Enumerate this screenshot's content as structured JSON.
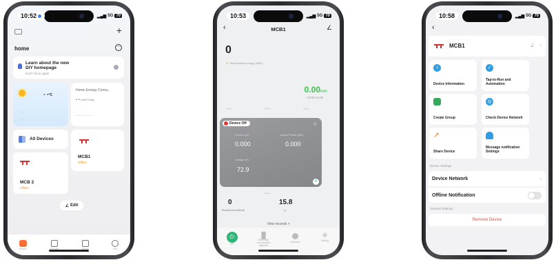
{
  "phone1": {
    "time": "10:52",
    "network": "5G",
    "battery": "70",
    "home_title": "home",
    "banner": {
      "title_line1": "Learn about the new",
      "title_line2": "DIY homepage",
      "subtitle": "Don't show again"
    },
    "weather": {
      "temp": "- -",
      "unit": "°C",
      "dashes1": "- -",
      "dashes2": "- -"
    },
    "energy": {
      "title": "Home Energy Consu...",
      "value": "- -",
      "unit": "kWh/Today",
      "dashes": "- - - - - - -"
    },
    "all_devices_label": "All Devices",
    "devices": [
      {
        "name": "MCB1",
        "status": "Offline"
      },
      {
        "name": "MCB 2",
        "status": "Offline"
      }
    ],
    "edit_label": "Edit",
    "tabs": [
      "Home",
      "Scenes",
      "Smart",
      "Me"
    ],
    "colors": {
      "offline": "#ff8a00",
      "accent": "#ff6b35"
    }
  },
  "phone2": {
    "time": "10:53",
    "network": "5G",
    "battery": "70",
    "title": "MCB1",
    "forward_value": "0",
    "forward_label": "Total forward energy (kWh)",
    "chart_value": "0.00",
    "chart_unit": "kWh",
    "chart_time": "10:00-11:00",
    "chart_axis": [
      "8:00",
      "10:00",
      "20:00"
    ],
    "device_status": "Device Off",
    "current_label": "Current (A)",
    "current_value": "0.000",
    "power_label": "Active Power (kW)",
    "power_value": "0.000",
    "voltage_label": "Voltage (V)",
    "voltage_value": "72.9",
    "badge": "A",
    "residual_value": "0",
    "residual_label": "Residual current(mA)",
    "temp_value": "15.8",
    "temp_label": "°C",
    "view_records": "View records >",
    "bottom": [
      {
        "label": "OFF",
        "icon": "power-icon"
      },
      {
        "label": "Electricity consumption statistics",
        "icon": "bars-icon"
      },
      {
        "label": "Schedule",
        "icon": "clock-icon"
      },
      {
        "label": "Setting",
        "icon": "gear-icon"
      }
    ],
    "colors": {
      "power_green": "#2eb57a",
      "chart_green": "#39c24a",
      "panel": "#8f9195",
      "status_red": "#e03a3a"
    }
  },
  "phone3": {
    "time": "10:58",
    "network": "5G",
    "battery": "70",
    "device_name": "MCB1",
    "tiles": [
      {
        "label": "Device Information",
        "icon": "info-icon",
        "color": "#2f9ee3"
      },
      {
        "label": "Tap-to-Run and Automation",
        "icon": "check-icon",
        "color": "#2f9ee3"
      },
      {
        "label": "Create Group",
        "icon": "group-icon",
        "color": "#35a85a"
      },
      {
        "label": "Check Device Network",
        "icon": "network-icon",
        "color": "#2f9ee3"
      },
      {
        "label": "Share Device",
        "icon": "share-icon",
        "color": "#f08a24"
      },
      {
        "label": "Message notification Settings",
        "icon": "bell-icon",
        "color": "#2f9ee3"
      }
    ],
    "section_device": "Device Settings",
    "device_network": "Device Network",
    "offline_notification": "Offline Notification",
    "section_general": "General Settings",
    "remove_device": "Remove Device",
    "colors": {
      "remove": "#e84a3c"
    }
  }
}
